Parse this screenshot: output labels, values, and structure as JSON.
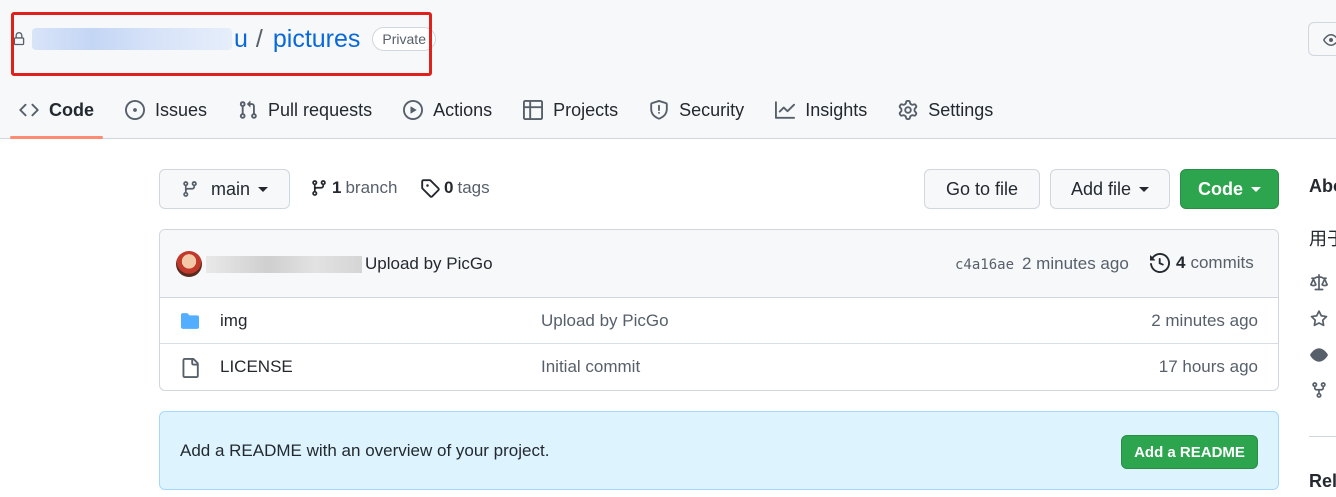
{
  "repo": {
    "owner_tail": "u",
    "separator": "/",
    "name": "pictures",
    "visibility": "Private"
  },
  "tabs": [
    {
      "label": "Code",
      "icon": "code-icon",
      "active": true
    },
    {
      "label": "Issues",
      "icon": "issue-opened-icon"
    },
    {
      "label": "Pull requests",
      "icon": "git-pull-request-icon"
    },
    {
      "label": "Actions",
      "icon": "play-icon"
    },
    {
      "label": "Projects",
      "icon": "table-icon"
    },
    {
      "label": "Security",
      "icon": "shield-icon"
    },
    {
      "label": "Insights",
      "icon": "graph-icon"
    },
    {
      "label": "Settings",
      "icon": "gear-icon"
    }
  ],
  "toolbar": {
    "branch": "main",
    "branch_count": "1",
    "branch_word": "branch",
    "tag_count": "0",
    "tag_word": "tags",
    "goto_file": "Go to file",
    "add_file": "Add file",
    "code": "Code"
  },
  "latest_commit": {
    "message": "Upload by PicGo",
    "sha": "c4a16ae",
    "time": "2 minutes ago",
    "commit_count": "4",
    "commit_word": "commits"
  },
  "files": [
    {
      "name": "img",
      "type": "folder",
      "message": "Upload by PicGo",
      "time": "2 minutes ago"
    },
    {
      "name": "LICENSE",
      "type": "file",
      "message": "Initial commit",
      "time": "17 hours ago"
    }
  ],
  "readme_banner": {
    "text": "Add a README with an overview of your project.",
    "button": "Add a README"
  },
  "sidebar": {
    "about_title": "Abo",
    "description": "用于",
    "releases_title": "Rel"
  },
  "colors": {
    "accent_link": "#0969da",
    "green_button": "#2da44e",
    "active_tab_underline": "#fd8c73",
    "annotation_box": "#e0201b"
  }
}
